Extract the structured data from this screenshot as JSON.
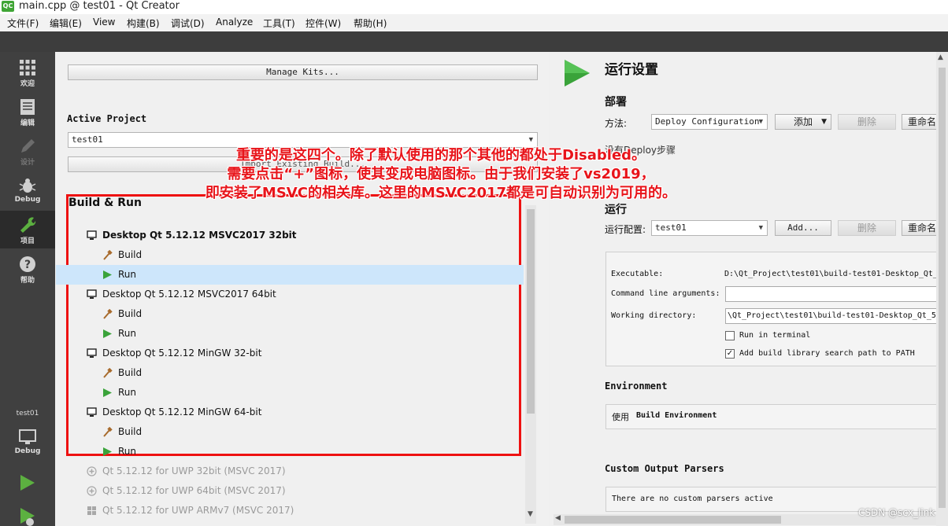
{
  "window": {
    "title": "main.cpp @ test01 - Qt Creator",
    "logo": "QC"
  },
  "menu": [
    "文件(F)",
    "编辑(E)",
    "View",
    "构建(B)",
    "调试(D)",
    "Analyze",
    "工具(T)",
    "控件(W)",
    "帮助(H)"
  ],
  "modes": {
    "welcome": "欢迎",
    "edit": "编辑",
    "design": "设计",
    "debug": "Debug",
    "projects": "项目",
    "help": "帮助",
    "target_project": "test01",
    "target_mode": "Debug"
  },
  "left": {
    "manage_kits": "Manage Kits...",
    "active_project_label": "Active Project",
    "active_project_value": "test01",
    "import_button": "Import Existing Build...",
    "build_run_title": "Build & Run",
    "kits": [
      {
        "name": "Desktop Qt 5.12.12 MSVC2017 32bit",
        "build": "Build",
        "run": "Run"
      },
      {
        "name": "Desktop Qt 5.12.12 MSVC2017 64bit",
        "build": "Build",
        "run": "Run"
      },
      {
        "name": "Desktop Qt 5.12.12 MinGW 32-bit",
        "build": "Build",
        "run": "Run"
      },
      {
        "name": "Desktop Qt 5.12.12 MinGW 64-bit",
        "build": "Build",
        "run": "Run"
      }
    ],
    "disabled_kits": [
      "Qt 5.12.12 for UWP 32bit (MSVC 2017)",
      "Qt 5.12.12 for UWP 64bit (MSVC 2017)",
      "Qt 5.12.12 for UWP ARMv7 (MSVC 2017)"
    ]
  },
  "right": {
    "title": "运行设置",
    "deploy_section": "部署",
    "method_label": "方法:",
    "deploy_config": "Deploy Configuration",
    "add_label": "添加",
    "delete_label": "删除",
    "rename_label": "重命名",
    "no_deploy_steps": "没有Deploy步骤",
    "run_section": "运行",
    "run_config_label": "运行配置:",
    "run_config": "test01",
    "add_ellipsis": "Add...",
    "executable_label": "Executable:",
    "executable_value": "D:\\Qt_Project\\test01\\build-test01-Desktop_Qt_",
    "cmd_args_label": "Command line arguments:",
    "cmd_args_value": "",
    "working_dir_label": "Working directory:",
    "working_dir_value": "\\Qt_Project\\test01\\build-test01-Desktop_Qt_5_",
    "run_in_terminal": "Run in terminal",
    "add_lib_path": "Add build library search path to PATH",
    "environment_section": "Environment",
    "use_prefix": "使用",
    "build_environment": "Build Environment",
    "custom_parsers_section": "Custom Output Parsers",
    "no_parsers": "There are no custom parsers active"
  },
  "annotation": {
    "line1_a": "重要的是这四个。除了默认使用的那个其他的都处于",
    "line1_b": "Disabled",
    "line1_c": "。",
    "line2_a": "需要点击“",
    "line2_b": "+",
    "line2_c": "”图标，使其变成电脑图标。由于我们安装了",
    "line2_d": "vs2019",
    "line2_e": "，",
    "line3": "即安装了MSVC的相关库。这里的MSVC2017都是可自动识别为可用的。"
  },
  "watermark": "CSDN @scx_link",
  "colors": {
    "annotation_red": "#e8141a",
    "run_green": "#3aa33a",
    "selection": "#cde6fb"
  }
}
